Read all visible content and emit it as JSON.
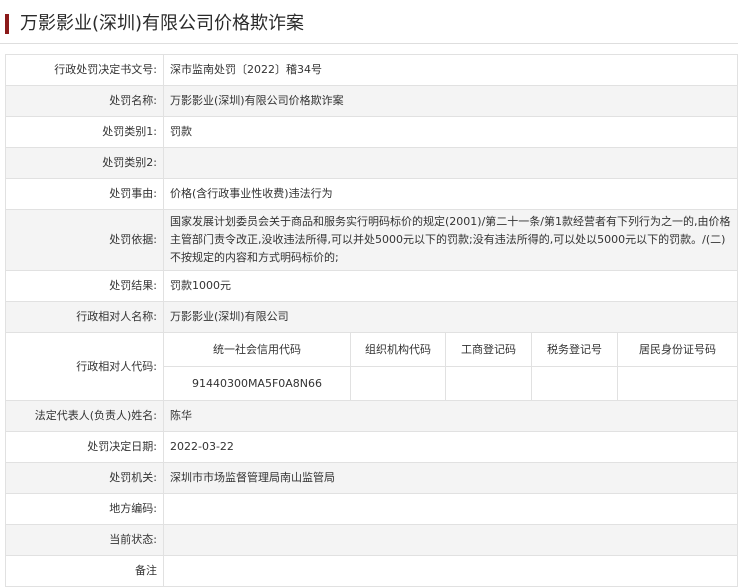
{
  "page": {
    "title": "万影影业(深圳)有限公司价格欺诈案"
  },
  "fields": {
    "decision_no_label": "行政处罚决定书文号:",
    "decision_no": "深市监南处罚〔2022〕稽34号",
    "case_name_label": "处罚名称:",
    "case_name": "万影影业(深圳)有限公司价格欺诈案",
    "category1_label": "处罚类别1:",
    "category1": "罚款",
    "category2_label": "处罚类别2:",
    "category2": "",
    "reason_label": "处罚事由:",
    "reason": "价格(含行政事业性收费)违法行为",
    "basis_label": "处罚依据:",
    "basis": "国家发展计划委员会关于商品和服务实行明码标价的规定(2001)/第二十一条/第1款经营者有下列行为之一的,由价格主管部门责令改正,没收违法所得,可以并处5000元以下的罚款;没有违法所得的,可以处以5000元以下的罚款。/(二)不按规定的内容和方式明码标价的;",
    "result_label": "处罚结果:",
    "result": "罚款1000元",
    "party_name_label": "行政相对人名称:",
    "party_name": "万影影业(深圳)有限公司",
    "party_code_label": "行政相对人代码:",
    "legal_rep_label": "法定代表人(负责人)姓名:",
    "legal_rep": "陈华",
    "decision_date_label": "处罚决定日期:",
    "decision_date": "2022-03-22",
    "authority_label": "处罚机关:",
    "authority": "深圳市市场监督管理局南山监管局",
    "region_code_label": "地方编码:",
    "region_code": "",
    "status_label": "当前状态:",
    "status": "",
    "remarks_label": "备注",
    "remarks": ""
  },
  "party_codes": {
    "headers": [
      "统一社会信用代码",
      "组织机构代码",
      "工商登记码",
      "税务登记号",
      "居民身份证号码"
    ],
    "values": [
      "91440300MA5F0A8N66",
      "",
      "",
      "",
      ""
    ]
  }
}
